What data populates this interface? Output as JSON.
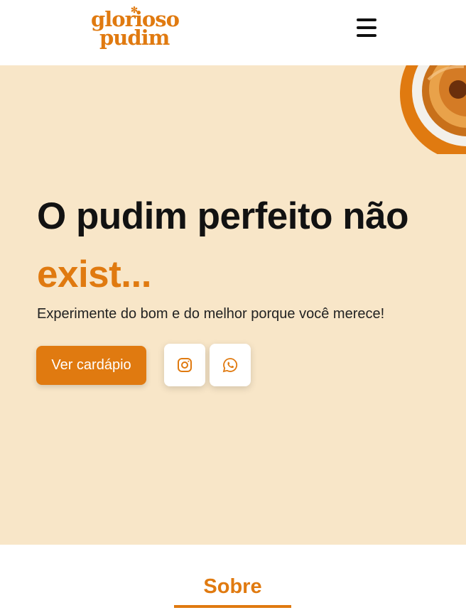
{
  "header": {
    "logo_line1": "glorioso",
    "logo_line2": "pudim",
    "menu_icon": "hamburger-menu-icon"
  },
  "hero": {
    "title": "O pudim perfeito não",
    "title_accent": "exist...",
    "subtitle": "Experimente do bom e do melhor porque você merece!",
    "cta_label": "Ver cardápio",
    "social_icons": [
      "instagram-icon",
      "whatsapp-icon"
    ]
  },
  "about": {
    "section_title": "Sobre"
  },
  "colors": {
    "brand": "#e07a10",
    "hero_bg": "#f8e6c8",
    "text": "#121212"
  }
}
